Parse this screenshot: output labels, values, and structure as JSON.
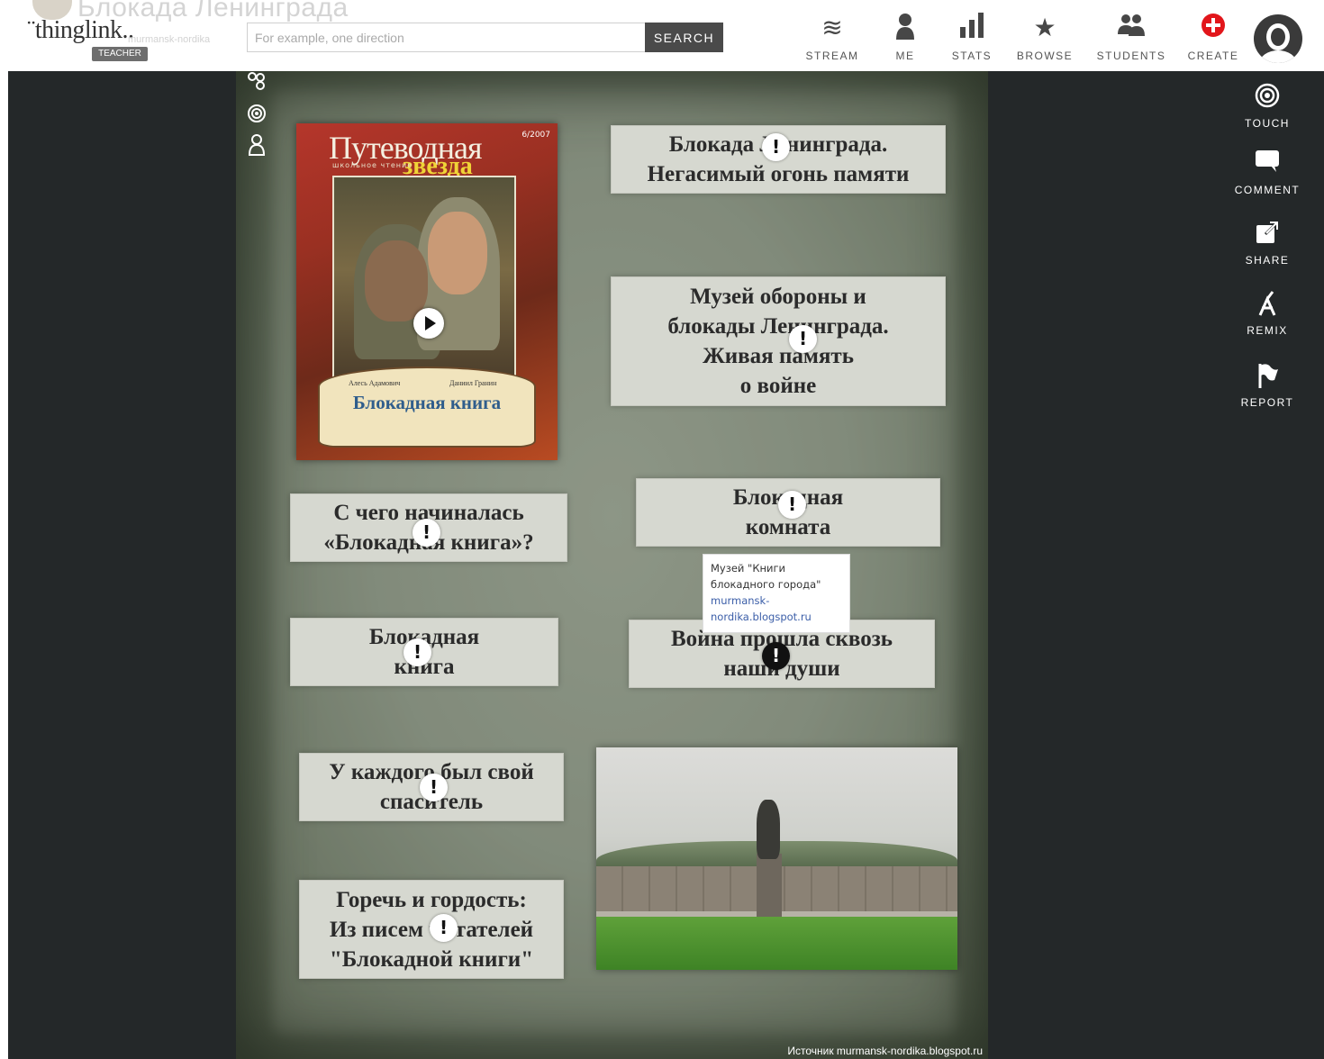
{
  "header": {
    "ghost_title": "Блокада Ленинграда",
    "logo": "¨thinglink..",
    "logo_sub": "murmansk-nordika",
    "badge": "TEACHER",
    "search": {
      "placeholder": "For example, one direction",
      "button": "SEARCH"
    },
    "nav": [
      {
        "label": "STREAM",
        "icon": "stream-icon"
      },
      {
        "label": "ME",
        "icon": "person-icon"
      },
      {
        "label": "STATS",
        "icon": "bar-chart-icon"
      },
      {
        "label": "BROWSE",
        "icon": "star-icon"
      },
      {
        "label": "STUDENTS",
        "icon": "group-icon"
      },
      {
        "label": "CREATE",
        "icon": "plus-circle-icon"
      }
    ]
  },
  "canvas": {
    "book": {
      "masthead": "Путеводная",
      "masthead2": "звезда",
      "issue": "6/2007",
      "subline": "школьное чтение",
      "author1": "Алесь Адамович",
      "author2": "Даниил Гранин",
      "title": "Блокадная книга"
    },
    "labels": [
      "Блокада Ленинграда.\nНегасимый огонь памяти",
      "Музей обороны и\nблокады Ленинграда.\nЖивая память\nо войне",
      "С чего начиналась\n«Блокадная книга»?",
      "Блокадная\nкомната",
      "Блокадная\nкнига",
      "Война прошла сквозь\nнаши души",
      "У каждого был свой\nспаситель",
      "Горечь и гордость:\nИз писем читателей\n\"Блокадной книги\""
    ],
    "tooltip": {
      "title": "Музей \"Книги блокадного города\"",
      "url": "murmansk-nordika.blogspot.ru"
    },
    "pin_glyph": "!",
    "source": "Источник murmansk-nordika.blogspot.ru"
  },
  "sidebar": [
    {
      "label": "TOUCH",
      "icon": "target-icon"
    },
    {
      "label": "COMMENT",
      "icon": "comment-icon"
    },
    {
      "label": "SHARE",
      "icon": "share-icon"
    },
    {
      "label": "REMIX",
      "icon": "remix-icon"
    },
    {
      "label": "REPORT",
      "icon": "flag-icon"
    }
  ]
}
